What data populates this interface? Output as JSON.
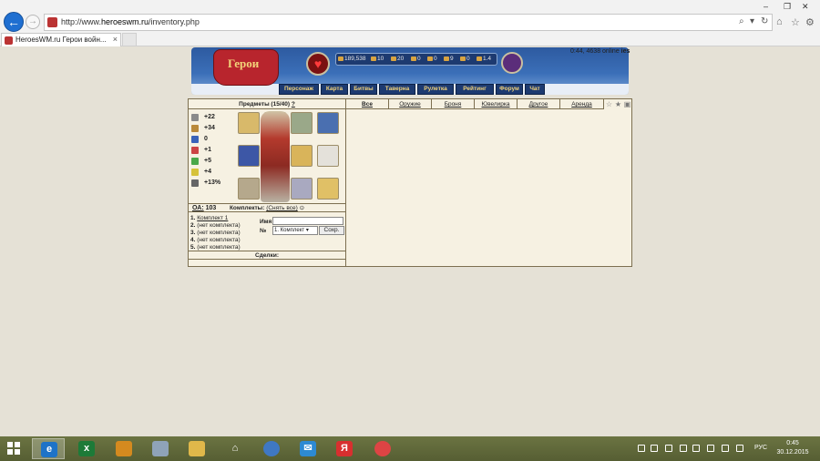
{
  "browser": {
    "url_prefix": "http://www.",
    "url_host": "heroeswm.ru",
    "url_path": "/inventory.php",
    "tab_title": "HeroesWM.ru Герои войн...",
    "tab_close": "×"
  },
  "header": {
    "logo_text": "Герои",
    "resources": [
      "189,538",
      "10",
      "20",
      "0",
      "0",
      "9",
      "0",
      "1.4"
    ],
    "online_text": "0:44, 4638 online",
    "online_suffix": "ies"
  },
  "nav": [
    "Персонаж",
    "Карта",
    "Битвы",
    "Таверна",
    "Рулетка",
    "Рейтинг",
    "Форум",
    "Чат"
  ],
  "inventory": {
    "title": "Предметы (15/40)",
    "help": "?",
    "stats": [
      "+22",
      "+34",
      "0",
      "+1",
      "+5",
      "+4",
      "+13%"
    ],
    "oa_label": "ОА:",
    "oa_value": "103"
  },
  "sets": {
    "title": "Комплекты:",
    "remove_all": "(Снять все)",
    "items": [
      {
        "num": "1.",
        "label": "Комплект 1"
      },
      {
        "num": "2.",
        "label": "(нет комплекта)"
      },
      {
        "num": "3.",
        "label": "(нет комплекта)"
      },
      {
        "num": "4.",
        "label": "(нет комплекта)"
      },
      {
        "num": "5.",
        "label": "(нет комплекта)"
      }
    ],
    "name_label": "Имя",
    "num_label": "№",
    "select_value": "1. Комплект",
    "save_label": "Сохр."
  },
  "deals_label": "Сделки:",
  "categories": [
    "Все",
    "Оружие",
    "Броня",
    "Ювелирка",
    "Другое",
    "Аренда"
  ],
  "taskbar": {
    "lang": "РУС",
    "time": "0:45",
    "date": "30.12.2015"
  }
}
